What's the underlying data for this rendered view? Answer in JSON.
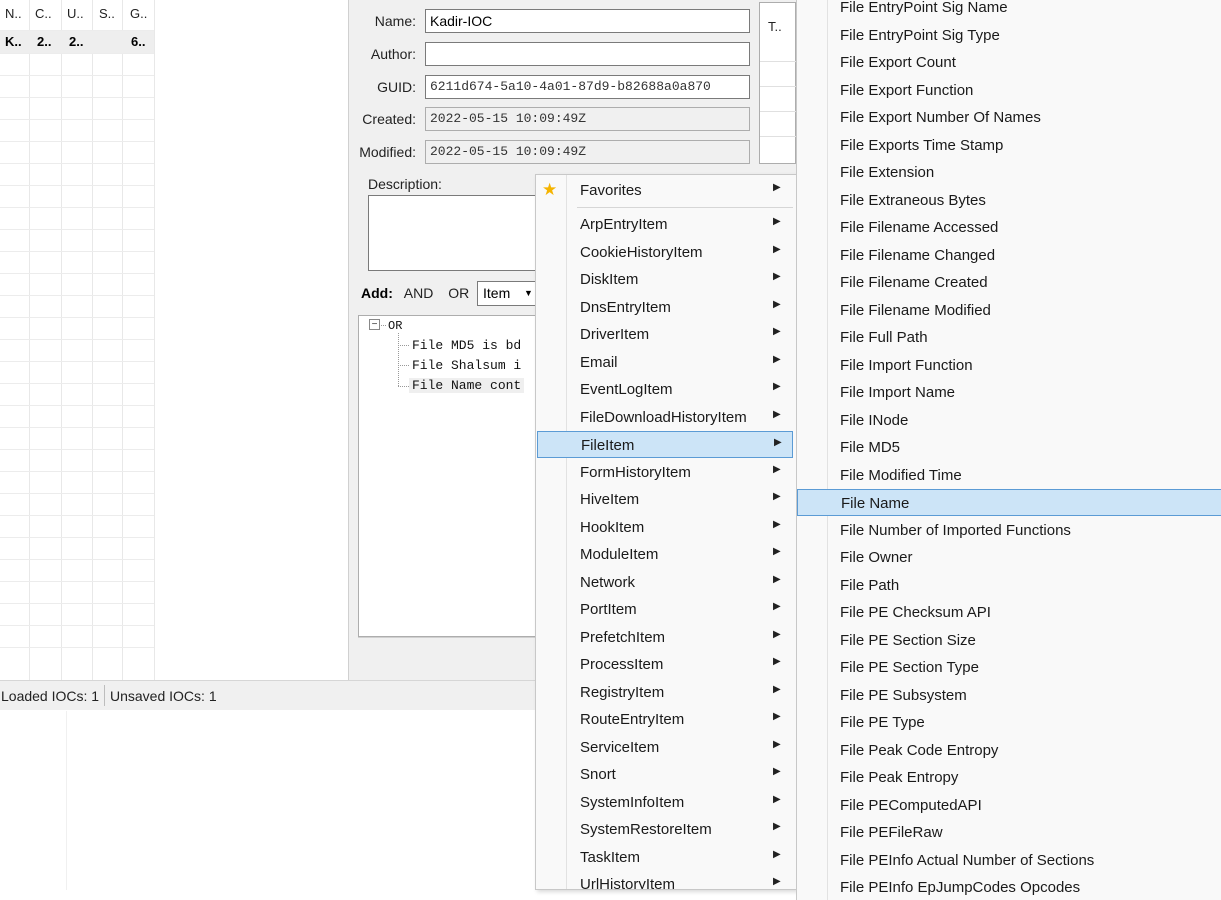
{
  "ioc_list": {
    "columns": [
      "N..",
      "C..",
      "U..",
      "S..",
      "G.."
    ],
    "row": [
      "K..",
      "2..",
      "2..",
      "",
      "6.."
    ]
  },
  "editor": {
    "name_label": "Name:",
    "name_value": "Kadir-IOC",
    "author_label": "Author:",
    "author_value": "",
    "guid_label": "GUID:",
    "guid_value": "6211d674-5a10-4a01-87d9-b82688a0a870",
    "created_label": "Created:",
    "created_value": "2022-05-15 10:09:49Z",
    "modified_label": "Modified:",
    "modified_value": "2022-05-15 10:09:49Z",
    "description_label": "Description:",
    "tab_label": "T..",
    "add_label": "Add:",
    "and_label": "AND",
    "or_label": "OR",
    "item_select": "Item",
    "tree": {
      "root": "OR",
      "children": [
        "File MD5 is bd",
        "File Shalsum i",
        "File Name cont"
      ]
    }
  },
  "status_bar": {
    "loaded": "Loaded IOCs: 1",
    "unsaved": "Unsaved IOCs: 1"
  },
  "context_menu": {
    "favorites": "Favorites",
    "items": [
      "ArpEntryItem",
      "CookieHistoryItem",
      "DiskItem",
      "DnsEntryItem",
      "DriverItem",
      "Email",
      "EventLogItem",
      "FileDownloadHistoryItem",
      "FileItem",
      "FormHistoryItem",
      "HiveItem",
      "HookItem",
      "ModuleItem",
      "Network",
      "PortItem",
      "PrefetchItem",
      "ProcessItem",
      "RegistryItem",
      "RouteEntryItem",
      "ServiceItem",
      "Snort",
      "SystemInfoItem",
      "SystemRestoreItem",
      "TaskItem",
      "UrlHistoryItem"
    ],
    "highlighted": "FileItem"
  },
  "submenu": {
    "items": [
      "File EntryPoint Sig Name",
      "File EntryPoint Sig Type",
      "File Export Count",
      "File Export Function",
      "File Export Number Of Names",
      "File Exports Time Stamp",
      "File Extension",
      "File Extraneous Bytes",
      "File Filename Accessed",
      "File Filename Changed",
      "File Filename Created",
      "File Filename Modified",
      "File Full Path",
      "File Import Function",
      "File Import Name",
      "File INode",
      "File MD5",
      "File Modified Time",
      "File Name",
      "File Number of Imported Functions",
      "File Owner",
      "File Path",
      "File PE Checksum API",
      "File PE Section Size",
      "File PE Section Type",
      "File PE Subsystem",
      "File PE Type",
      "File Peak Code Entropy",
      "File Peak Entropy",
      "File PEComputedAPI",
      "File PEFileRaw",
      "File PEInfo Actual Number of Sections",
      "File PEInfo EpJumpCodes Opcodes"
    ],
    "highlighted": "File Name"
  },
  "colors": {
    "highlight_bg": "#cce4f7",
    "highlight_border": "#5b9bd5",
    "star": "#f5b400"
  }
}
